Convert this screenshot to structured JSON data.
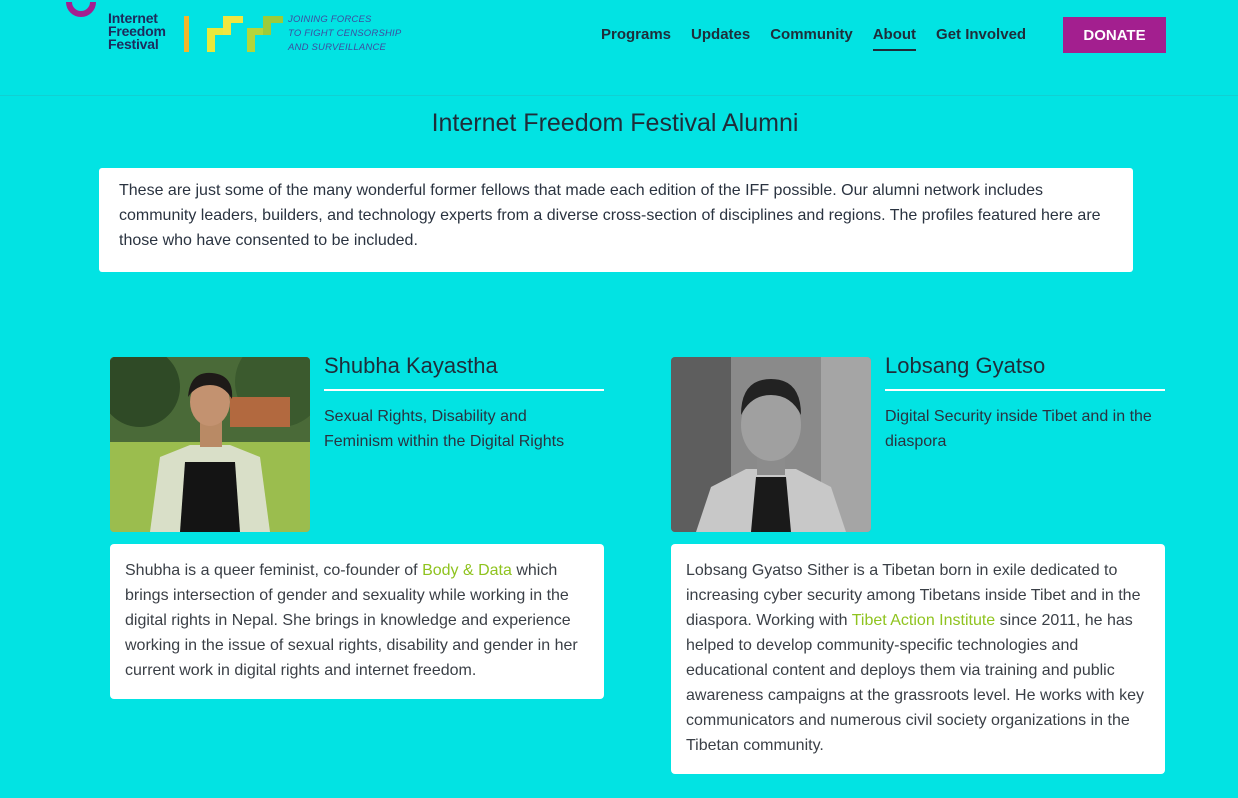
{
  "header": {
    "logo_lines": [
      "Internet",
      "Freedom",
      "Festival"
    ],
    "tagline_lines": [
      "Joining forces",
      "to fight censorship",
      "and surveillance"
    ],
    "nav": [
      {
        "label": "Programs",
        "active": false
      },
      {
        "label": "Updates",
        "active": false
      },
      {
        "label": "Community",
        "active": false
      },
      {
        "label": "About",
        "active": true
      },
      {
        "label": "Get Involved",
        "active": false
      }
    ],
    "donate_label": "DONATE"
  },
  "page": {
    "title": "Internet Freedom Festival Alumni",
    "intro": "These are just some of the many wonderful former fellows that made each edition of the IFF possible. Our alumni network includes community leaders, builders, and technology experts from a diverse cross-section of disciplines and regions. The profiles featured here are those who have consented to be included."
  },
  "alumni": [
    {
      "name": "Shubha Kayastha",
      "topic": "Sexual Rights, Disability and Feminism within the Digital Rights",
      "bio_before": "Shubha is a queer feminist, co-founder of ",
      "bio_link": "Body & Data",
      "bio_after": " which brings intersection of gender and sexuality while working in the digital rights in Nepal. She brings in knowledge and experience working in the issue of sexual rights, disability and gender in her current work in digital rights and internet freedom."
    },
    {
      "name": "Lobsang Gyatso",
      "topic": "Digital Security inside Tibet and in the diaspora",
      "bio_before": "Lobsang Gyatso Sither is a Tibetan born in exile dedicated to increasing cyber security among Tibetans inside Tibet and in the diaspora. Working with ",
      "bio_link": "Tibet Action Institute",
      "bio_after": " since 2011, he has helped to develop community-specific technologies and educational content and deploys them via training and public awareness campaigns at the grassroots level. He works with key communicators and numerous civil society organizations in the Tibetan community."
    }
  ],
  "colors": {
    "background": "#02e3e3",
    "donate": "#a31f8f",
    "link": "#8fc31f",
    "text": "#1f2d3a"
  }
}
